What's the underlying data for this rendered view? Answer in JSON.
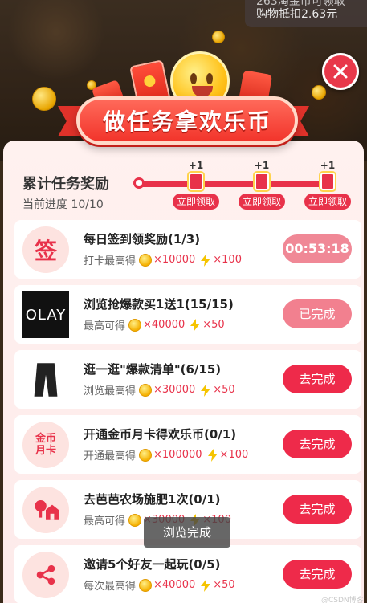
{
  "top_notice": {
    "line1": "263淘金币可领取",
    "line2": "购物抵扣2.63元"
  },
  "banner": {
    "title": "做任务拿欢乐币"
  },
  "progress": {
    "title": "累计任务奖励",
    "subtitle": "当前进度 10/10",
    "milestones": [
      {
        "plus": "+1",
        "claim": "立即领取"
      },
      {
        "plus": "+1",
        "claim": "立即领取"
      },
      {
        "plus": "+1",
        "claim": "立即领取"
      }
    ]
  },
  "tasks": [
    {
      "icon": "sign-in-icon",
      "icon_text": "签",
      "name": "每日签到领奖励(1/3)",
      "reward_prefix": "打卡最高得",
      "coins": "×10000",
      "energy": "×100",
      "button": "00:53:18"
    },
    {
      "icon": "olay-logo",
      "icon_text": "OLAY",
      "name": "浏览抢爆款买1送1(15/15)",
      "reward_prefix": "最高可得",
      "coins": "×40000",
      "energy": "×50",
      "button": "已完成"
    },
    {
      "icon": "pants-icon",
      "icon_text": "",
      "name": "逛一逛\"爆款清单\"(6/15)",
      "reward_prefix": "浏览最高得",
      "coins": "×30000",
      "energy": "×50",
      "button": "去完成"
    },
    {
      "icon": "gold-card-icon",
      "icon_text": "金币月卡",
      "name": "开通金币月卡得欢乐币(0/1)",
      "reward_prefix": "开通最高得",
      "coins": "×100000",
      "energy": "×100",
      "button": "去完成"
    },
    {
      "icon": "farm-icon",
      "icon_text": "",
      "name": "去芭芭农场施肥1次(0/1)",
      "reward_prefix": "最高可得",
      "coins": "×30000",
      "energy": "×100",
      "button": "去完成"
    },
    {
      "icon": "share-icon",
      "icon_text": "",
      "name": "邀请5个好友一起玩(0/5)",
      "reward_prefix": "每次最高得",
      "coins": "×40000",
      "energy": "×50",
      "button": "去完成"
    }
  ],
  "toast": "浏览完成",
  "watermark": "@CSDN博客",
  "colors": {
    "accent": "#ee2a4a",
    "timer": "#f08896",
    "done": "#f2808f",
    "panel": "#fff1ef"
  }
}
